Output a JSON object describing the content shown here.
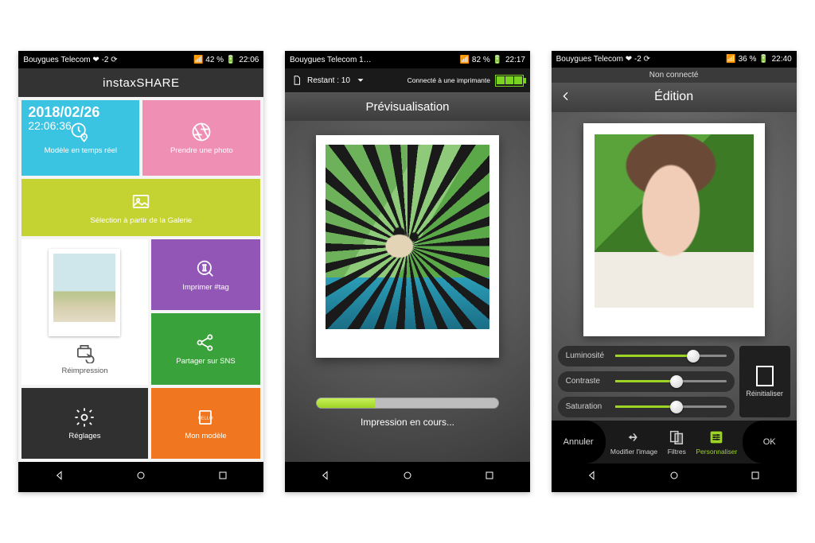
{
  "screens": {
    "home": {
      "status": {
        "carrier": "Bouygues Telecom ❤ -2 ⟳",
        "battery": "42 %",
        "time": "22:06"
      },
      "appTitle_bold": "instax",
      "appTitle_light": " SHARE",
      "date": "2018/02/26",
      "clock": "22:06:36",
      "tiles": {
        "realtime": "Modèle en temps réel",
        "takePhoto": "Prendre une photo",
        "gallery": "Sélection à partir de la Galerie",
        "reprint": "Réimpression",
        "settings": "Réglages",
        "printTag": "Imprimer #tag",
        "shareSns": "Partager sur SNS",
        "myModel": "Mon modèle"
      }
    },
    "preview": {
      "status": {
        "carrier": "Bouygues Telecom 1…",
        "battery": "82 %",
        "time": "22:17"
      },
      "remaining_label": "Restant : ",
      "remaining_value": "10",
      "printerStatus": "Connecté à une imprimante",
      "title": "Prévisualisation",
      "progressText": "Impression en cours...",
      "progressPct": 32
    },
    "edit": {
      "status": {
        "carrier": "Bouygues Telecom ❤ -2 ⟳",
        "battery": "36 %",
        "time": "22:40"
      },
      "notConnected": "Non connecté",
      "title": "Édition",
      "sliders": {
        "lum": {
          "label": "Luminosité",
          "value": 70
        },
        "con": {
          "label": "Contraste",
          "value": 55
        },
        "sat": {
          "label": "Saturation",
          "value": 55
        }
      },
      "reset": "Réinitialiser",
      "cancel": "Annuler",
      "ok": "OK",
      "tabs": {
        "modify": "Modifier l'image",
        "filters": "Filtres",
        "custom": "Personnaliser"
      }
    }
  }
}
